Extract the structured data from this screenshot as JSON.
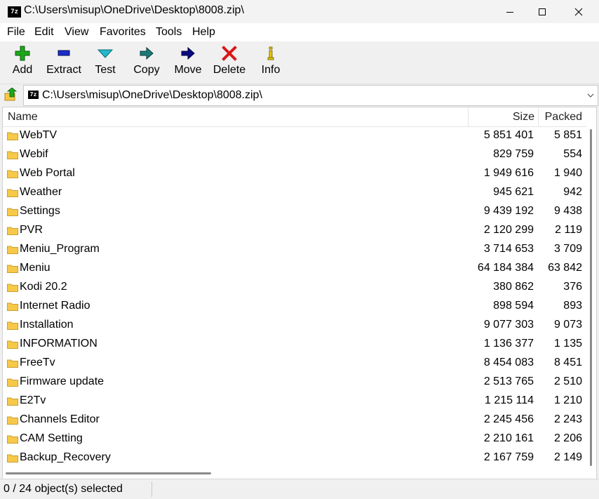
{
  "window": {
    "title": "C:\\Users\\misup\\OneDrive\\Desktop\\8008.zip\\",
    "app_icon_text": "7z"
  },
  "menu": [
    "File",
    "Edit",
    "View",
    "Favorites",
    "Tools",
    "Help"
  ],
  "toolbar": {
    "add": "Add",
    "extract": "Extract",
    "test": "Test",
    "copy": "Copy",
    "move": "Move",
    "delete": "Delete",
    "info": "Info"
  },
  "address": {
    "icon_text": "7z",
    "path": "C:\\Users\\misup\\OneDrive\\Desktop\\8008.zip\\"
  },
  "columns": {
    "name": "Name",
    "size": "Size",
    "packed": "Packed"
  },
  "rows": [
    {
      "name": "WebTV",
      "size": "5 851 401",
      "packed": "5 851"
    },
    {
      "name": "Webif",
      "size": "829 759",
      "packed": "554"
    },
    {
      "name": "Web Portal",
      "size": "1 949 616",
      "packed": "1 940"
    },
    {
      "name": "Weather",
      "size": "945 621",
      "packed": "942"
    },
    {
      "name": "Settings",
      "size": "9 439 192",
      "packed": "9 438"
    },
    {
      "name": "PVR",
      "size": "2 120 299",
      "packed": "2 119"
    },
    {
      "name": "Meniu_Program",
      "size": "3 714 653",
      "packed": "3 709"
    },
    {
      "name": "Meniu",
      "size": "64 184 384",
      "packed": "63 842"
    },
    {
      "name": "Kodi 20.2",
      "size": "380 862",
      "packed": "376"
    },
    {
      "name": "Internet Radio",
      "size": "898 594",
      "packed": "893"
    },
    {
      "name": "Installation",
      "size": "9 077 303",
      "packed": "9 073"
    },
    {
      "name": "INFORMATION",
      "size": "1 136 377",
      "packed": "1 135"
    },
    {
      "name": "FreeTv",
      "size": "8 454 083",
      "packed": "8 451"
    },
    {
      "name": "Firmware update",
      "size": "2 513 765",
      "packed": "2 510"
    },
    {
      "name": "E2Tv",
      "size": "1 215 114",
      "packed": "1 210"
    },
    {
      "name": "Channels Editor",
      "size": "2 245 456",
      "packed": "2 243"
    },
    {
      "name": "CAM Setting",
      "size": "2 210 161",
      "packed": "2 206"
    },
    {
      "name": "Backup_Recovery",
      "size": "2 167 759",
      "packed": "2 149"
    }
  ],
  "status": {
    "selection": "0 / 24 object(s) selected"
  },
  "colors": {
    "folder": "#f7c948",
    "add_icon": "#1aa81a",
    "extract_icon": "#1a2ec8",
    "test_icon": "#22b8c8",
    "copy_icon": "#1a7a7a",
    "move_icon": "#0a0a80",
    "delete_icon": "#d81818",
    "info_icon": "#e8c800"
  }
}
